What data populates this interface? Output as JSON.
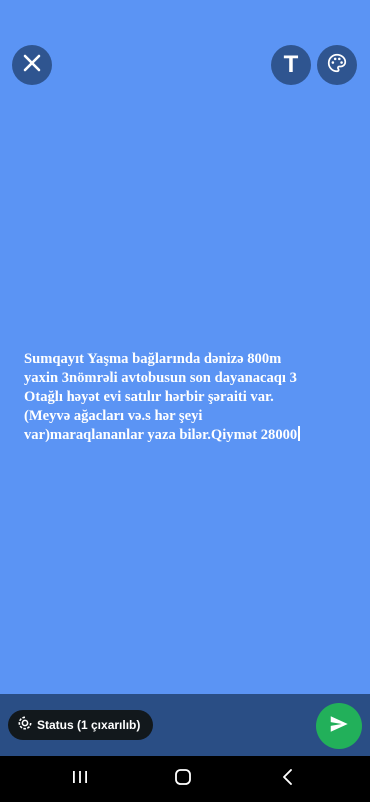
{
  "colors": {
    "canvas_background": "#5b94f4",
    "bottom_bar": "#2a4e85",
    "send_button": "#22b05a",
    "status_pill": "#12181c"
  },
  "toolbar": {
    "close_icon": "close-icon",
    "text_button_glyph": "T",
    "palette_icon": "palette-icon"
  },
  "status": {
    "text": "Sumqayıt Yaşma bağlarında dənizə 800m\nyaxin 3nömrəli avtobusun son dayanacaqı 3\nOtağlı həyət evi satılır hərbir şəraiti var.\n(Meyvə ağacları və.s hər şeyi\nvar)maraqlananlar yaza bilər.Qiymət 28000"
  },
  "bottom": {
    "privacy_label": "Status (1 çıxarılıb)",
    "send_icon": "send-icon"
  },
  "navigation": {
    "recents_icon": "recents-icon",
    "home_icon": "home-icon",
    "back_icon": "back-icon"
  }
}
